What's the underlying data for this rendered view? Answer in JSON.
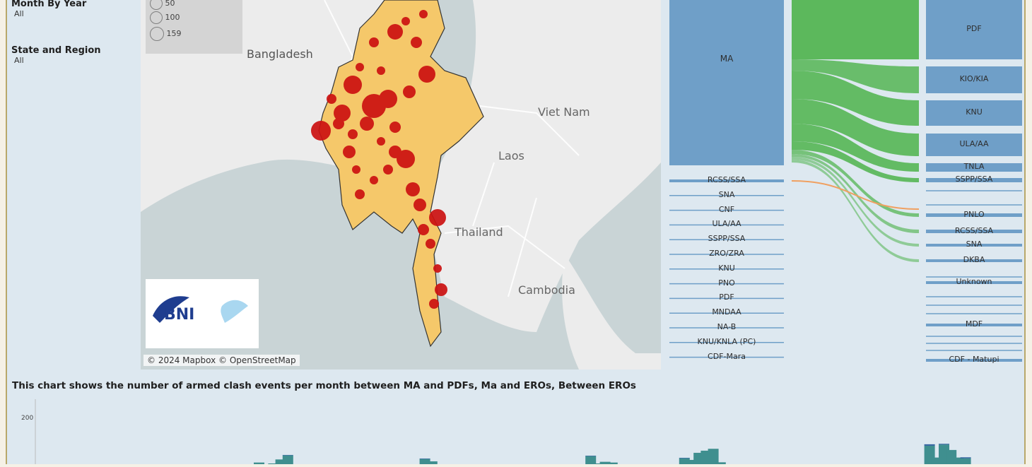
{
  "filters": [
    {
      "title": "Month By Year",
      "value": "All"
    },
    {
      "title": "State and Region",
      "value": "All"
    }
  ],
  "map": {
    "size_legend": [
      "50",
      "100",
      "159"
    ],
    "labels": {
      "bangladesh": "Bangladesh",
      "vietnam": "Viet Nam",
      "laos": "Laos",
      "thailand": "Thailand",
      "cambodia": "Cambodia"
    },
    "copyright": "© 2024 Mapbox © OpenStreetMap",
    "logo_text": "BNI"
  },
  "sankey": {
    "left_big": "MA",
    "left_small": [
      "RCSS/SSA",
      "SNA",
      "CNF",
      "ULA/AA",
      "SSPP/SSA",
      "ZRO/ZRA",
      "KNU",
      "PNO",
      "PDF",
      "MNDAA",
      "NA-B",
      "KNU/KNLA (PC)",
      "CDF-Mara"
    ],
    "right": [
      "PDF",
      "KIO/KIA",
      "KNU",
      "ULA/AA",
      "TNLA",
      "SSPP/SSA",
      "PNLO",
      "RCSS/SSA",
      "SNA",
      "DKBA",
      "Unknown",
      "MDF",
      "CDF - Matupi"
    ],
    "colors": {
      "node": "#6f9fc8",
      "flow_main": "#5cb85c",
      "flow_orange": "#f0a060"
    }
  },
  "chart": {
    "caption": "This chart shows the number of armed clash events per month between MA and PDFs, Ma and EROs, Between EROs",
    "y_tick": "200"
  },
  "chart_data": {
    "type": "bar",
    "y_tick_labels": [
      "200"
    ],
    "ylim": [
      0,
      200
    ],
    "values": [
      0,
      0,
      0,
      0,
      0,
      0,
      0,
      0,
      0,
      0,
      0,
      0,
      0,
      0,
      0,
      0,
      0,
      0,
      0,
      0,
      0,
      0,
      0,
      0,
      0,
      0,
      0,
      0,
      0,
      0,
      7,
      0,
      3,
      20,
      37,
      0,
      0,
      0,
      0,
      0,
      0,
      0,
      0,
      0,
      0,
      0,
      0,
      0,
      0,
      0,
      0,
      0,
      0,
      22,
      12,
      0,
      0,
      0,
      0,
      0,
      0,
      0,
      0,
      0,
      0,
      0,
      0,
      0,
      0,
      0,
      0,
      0,
      0,
      0,
      0,
      0,
      34,
      3,
      10,
      7,
      0,
      0,
      0,
      0,
      0,
      0,
      0,
      0,
      0,
      25,
      18,
      48,
      57,
      65,
      8,
      0,
      0,
      0,
      0,
      0,
      0,
      0,
      0,
      0,
      0,
      0,
      0,
      0,
      0,
      0,
      0,
      0,
      0,
      0,
      0,
      0,
      0,
      0,
      0,
      0,
      0,
      0,
      0,
      78,
      28,
      83,
      60,
      28,
      25,
      0,
      0
    ],
    "cap": [
      0,
      0,
      0,
      0,
      0,
      0,
      0,
      0,
      0,
      0,
      0,
      0,
      0,
      0,
      0,
      0,
      0,
      0,
      0,
      0,
      0,
      0,
      0,
      0,
      0,
      0,
      0,
      0,
      0,
      0,
      0,
      0,
      0,
      0,
      2,
      0,
      0,
      0,
      0,
      0,
      0,
      0,
      0,
      0,
      0,
      0,
      0,
      0,
      0,
      0,
      0,
      0,
      0,
      2,
      0,
      0,
      0,
      0,
      0,
      0,
      0,
      0,
      0,
      0,
      0,
      0,
      0,
      0,
      0,
      0,
      0,
      0,
      0,
      0,
      0,
      0,
      2,
      0,
      0,
      0,
      0,
      0,
      0,
      0,
      0,
      0,
      0,
      0,
      0,
      2,
      0,
      0,
      0,
      0,
      0,
      0,
      0,
      0,
      0,
      0,
      0,
      0,
      0,
      0,
      0,
      0,
      0,
      0,
      0,
      0,
      0,
      0,
      0,
      0,
      0,
      0,
      0,
      0,
      0,
      0,
      0,
      0,
      0,
      6,
      0,
      3,
      0,
      0,
      4,
      0,
      0
    ],
    "colors": {
      "bar": "#3f8f8f",
      "cap": "#2e5f9e"
    }
  }
}
